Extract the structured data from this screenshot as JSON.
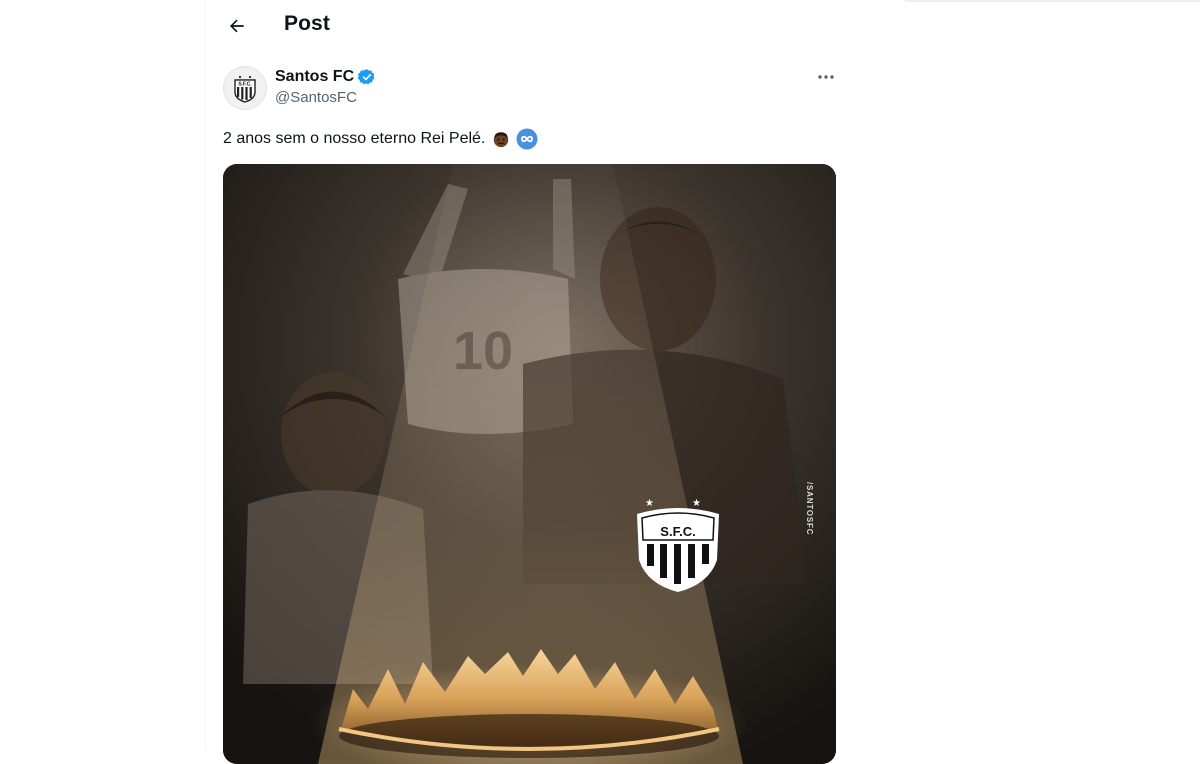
{
  "header": {
    "back_label": "Back",
    "title": "Post"
  },
  "post": {
    "author": {
      "display_name": "Santos FC",
      "handle": "@SantosFC",
      "verified": true,
      "avatar": "santos-crest"
    },
    "text": "2 anos sem o nosso eterno Rei Pelé.",
    "emojis": [
      "dark-skin-face-emoji",
      "infinity-emoji"
    ],
    "more_label": "More",
    "media": {
      "crest_text": "S.F.C.",
      "side_text": "/SANTOSFC",
      "jersey_number": "10"
    }
  },
  "colors": {
    "text_primary": "#0f1419",
    "text_secondary": "#536471",
    "verified_blue": "#1d9bf0",
    "media_dark": "#1e1b18",
    "gold": "#d9a35a"
  }
}
